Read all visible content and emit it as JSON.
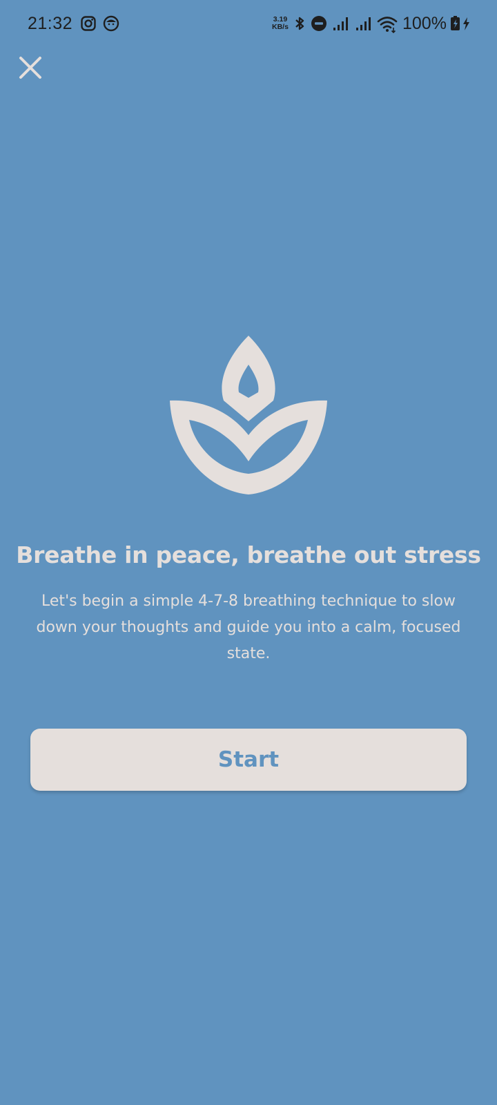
{
  "status_bar": {
    "time": "21:32",
    "net_speed_value": "3.19",
    "net_speed_unit": "KB/s",
    "battery": "100%",
    "icons": [
      "instagram-icon",
      "notification-app-icon",
      "bluetooth-icon",
      "do-not-disturb-icon",
      "signal-icon",
      "signal-icon",
      "wifi-icon",
      "battery-charging-icon"
    ]
  },
  "colors": {
    "background": "#6093bf",
    "foreground": "#e5dfdc"
  },
  "content": {
    "headline": "Breathe in peace, breathe out stress",
    "description": "Let's begin a simple 4-7-8 breathing technique to slow down your thoughts and guide you into a calm, focused state.",
    "start_label": "Start"
  }
}
